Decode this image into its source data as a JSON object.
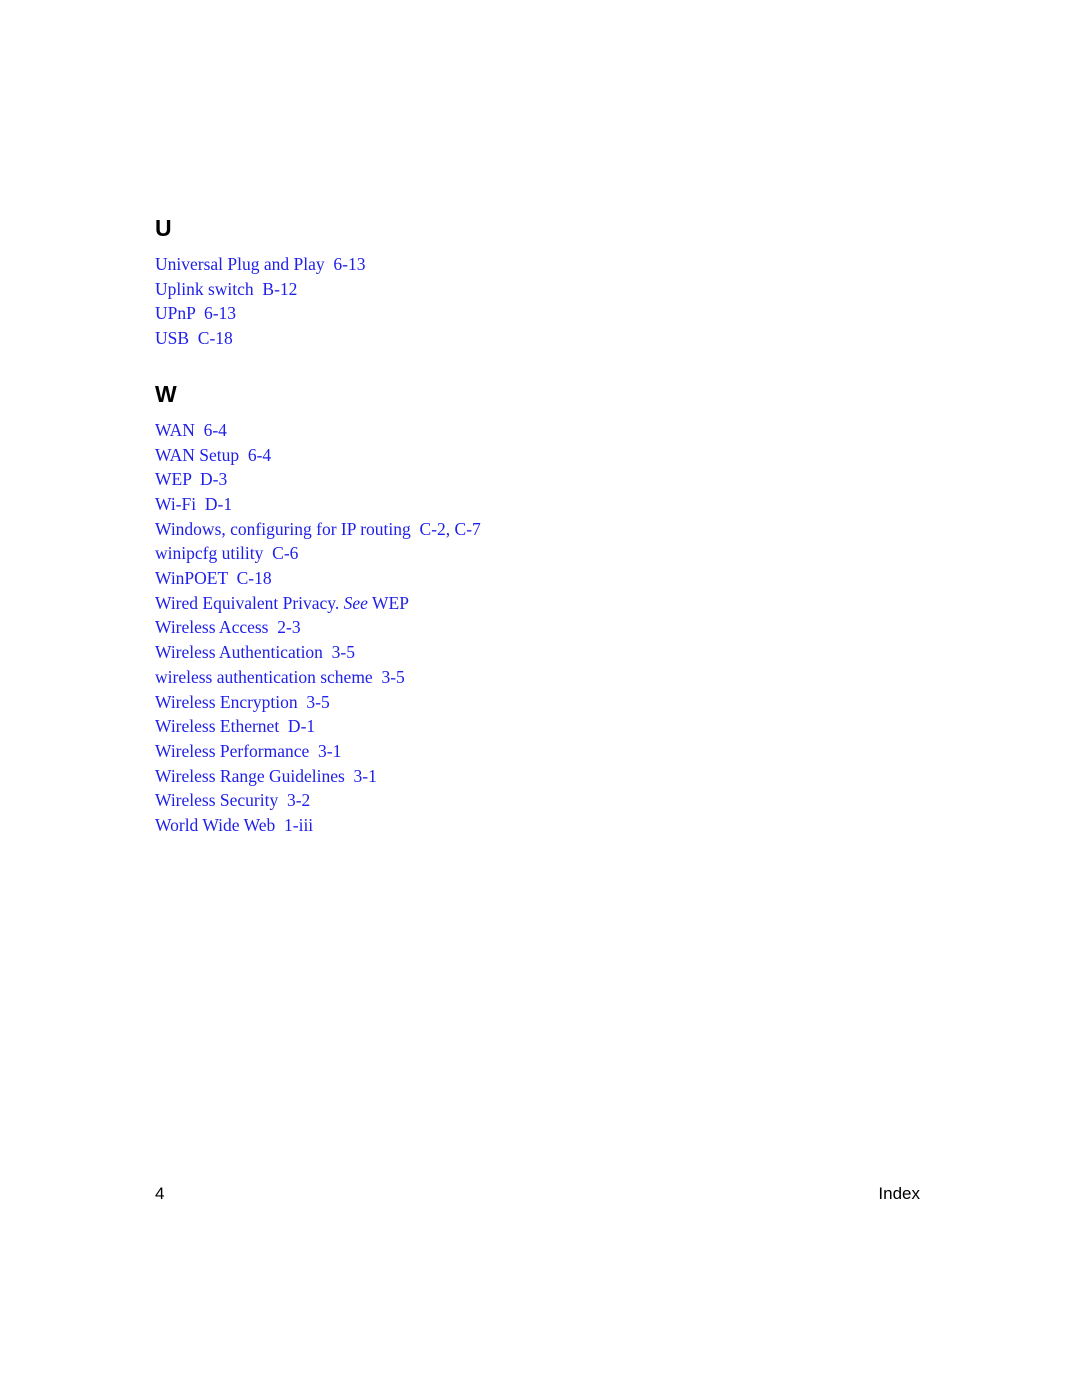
{
  "document": {
    "type": "index-page",
    "entry_color": "#2020e8",
    "heading_color": "#000000"
  },
  "sections": [
    {
      "letter": "U",
      "entries": [
        {
          "text": "Universal Plug and Play  6-13"
        },
        {
          "text": "Uplink switch  B-12"
        },
        {
          "text": "UPnP  6-13"
        },
        {
          "text": "USB  C-18"
        }
      ]
    },
    {
      "letter": "W",
      "entries": [
        {
          "text": "WAN  6-4"
        },
        {
          "text": "WAN Setup  6-4"
        },
        {
          "text": "WEP  D-3"
        },
        {
          "text": "Wi-Fi  D-1"
        },
        {
          "text": "Windows, configuring for IP routing  C-2, C-7"
        },
        {
          "text": "winipcfg utility  C-6"
        },
        {
          "text": "WinPOET  C-18"
        },
        {
          "text": "Wired Equivalent Privacy. ",
          "italic": "See",
          "tail": " WEP"
        },
        {
          "text": "Wireless Access  2-3"
        },
        {
          "text": "Wireless Authentication  3-5"
        },
        {
          "text": "wireless authentication scheme  3-5"
        },
        {
          "text": "Wireless Encryption  3-5"
        },
        {
          "text": "Wireless Ethernet  D-1"
        },
        {
          "text": "Wireless Performance  3-1"
        },
        {
          "text": "Wireless Range Guidelines  3-1"
        },
        {
          "text": "Wireless Security  3-2"
        },
        {
          "text": "World Wide Web  1-iii"
        }
      ]
    }
  ],
  "footer": {
    "page_number": "4",
    "label": "Index"
  }
}
